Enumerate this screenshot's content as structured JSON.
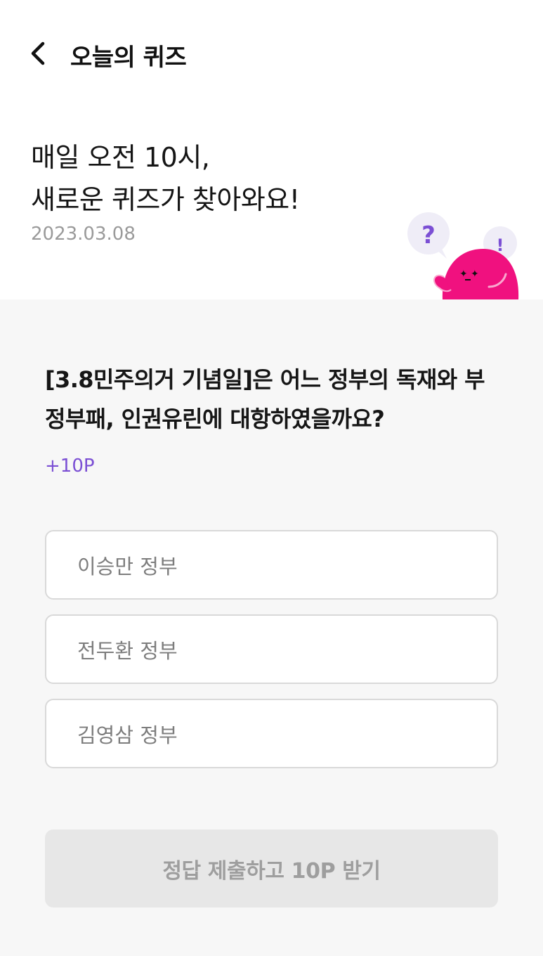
{
  "header": {
    "title": "오늘의 퀴즈",
    "back_icon": "chevron-left-icon"
  },
  "banner": {
    "line1": "매일 오전 10시,",
    "line2": "새로운 퀴즈가 찾아와요!",
    "date": "2023.03.08",
    "bubble_question": "?",
    "bubble_exclaim": "!"
  },
  "quiz": {
    "question": "[3.8민주의거 기념일]은 어느 정부의 독재와 부정부패, 인권유린에 대항하였을까요?",
    "points": "+10P",
    "options": [
      {
        "label": "이승만 정부"
      },
      {
        "label": "전두환 정부"
      },
      {
        "label": "김영삼 정부"
      }
    ]
  },
  "submit": {
    "label": "정답 제출하고 10P 받기",
    "enabled": false
  },
  "colors": {
    "accent": "#7b4fd4",
    "mascot": "#f0117f",
    "background": "#f7f7f7"
  }
}
